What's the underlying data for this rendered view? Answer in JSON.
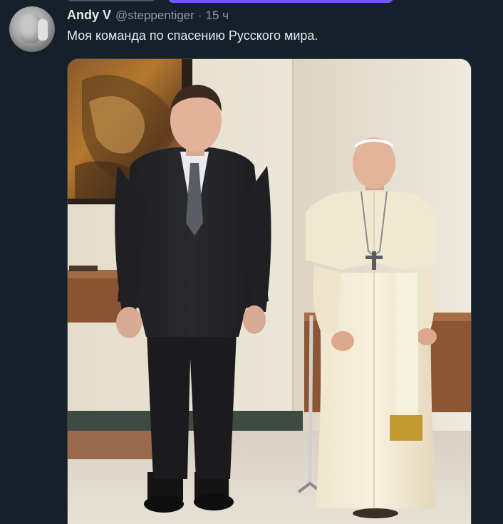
{
  "tweet": {
    "author_name": "Andy V",
    "author_handle": "@steppentiger",
    "separator": "·",
    "time": "15 ч",
    "text": "Моя команда по спасению Русского мира."
  },
  "icons": {
    "avatar": "user-avatar"
  },
  "colors": {
    "background": "#15202b",
    "primary_text": "#e7e9ea",
    "secondary_text": "#8b98a5",
    "card_border": "#38444d",
    "accent": "#7856ff"
  }
}
